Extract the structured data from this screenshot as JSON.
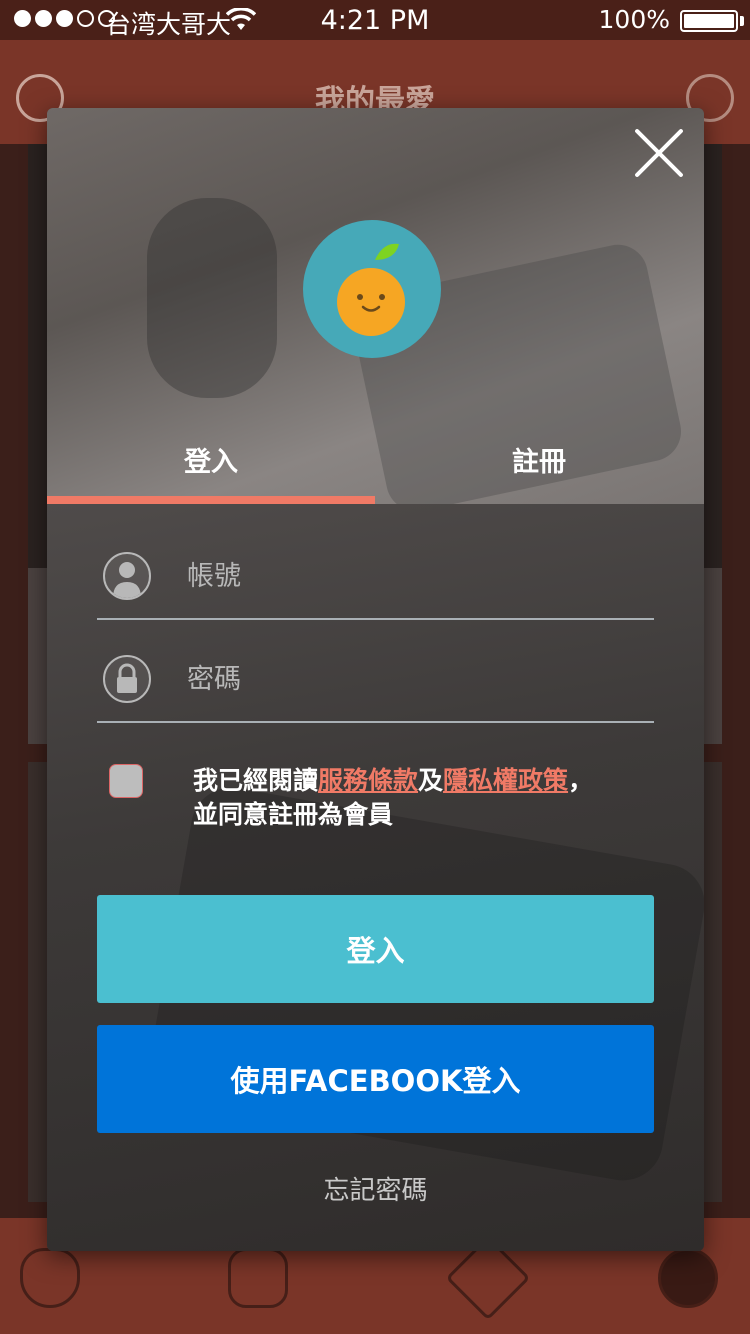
{
  "status_bar": {
    "carrier": "台湾大哥大",
    "time": "4:21 PM",
    "battery": "100%"
  },
  "background": {
    "title": "我的最愛"
  },
  "modal": {
    "tabs": {
      "login": "登入",
      "register": "註冊"
    },
    "fields": {
      "account_placeholder": "帳號",
      "password_placeholder": "密碼"
    },
    "agreement": {
      "prefix": "我已經閱讀",
      "terms_link": "服務條款",
      "and": "及",
      "privacy_link": "隱私權政策",
      "comma": "，",
      "suffix": "並同意註冊為會員"
    },
    "buttons": {
      "login": "登入",
      "facebook_login": "使用FACEBOOK登入"
    },
    "forgot_password": "忘記密碼"
  },
  "colors": {
    "accent": "#f07a66",
    "login_button": "#4bbfd0",
    "facebook_button": "#0074d9",
    "logo_circle": "#46a9b8",
    "logo_orange": "#f6a623"
  },
  "icons": [
    "wifi-icon",
    "battery-icon",
    "back-icon",
    "refresh-icon",
    "close-icon",
    "user-icon",
    "lock-icon",
    "fire-icon",
    "hand-icon",
    "heart-icon",
    "profile-icon"
  ]
}
